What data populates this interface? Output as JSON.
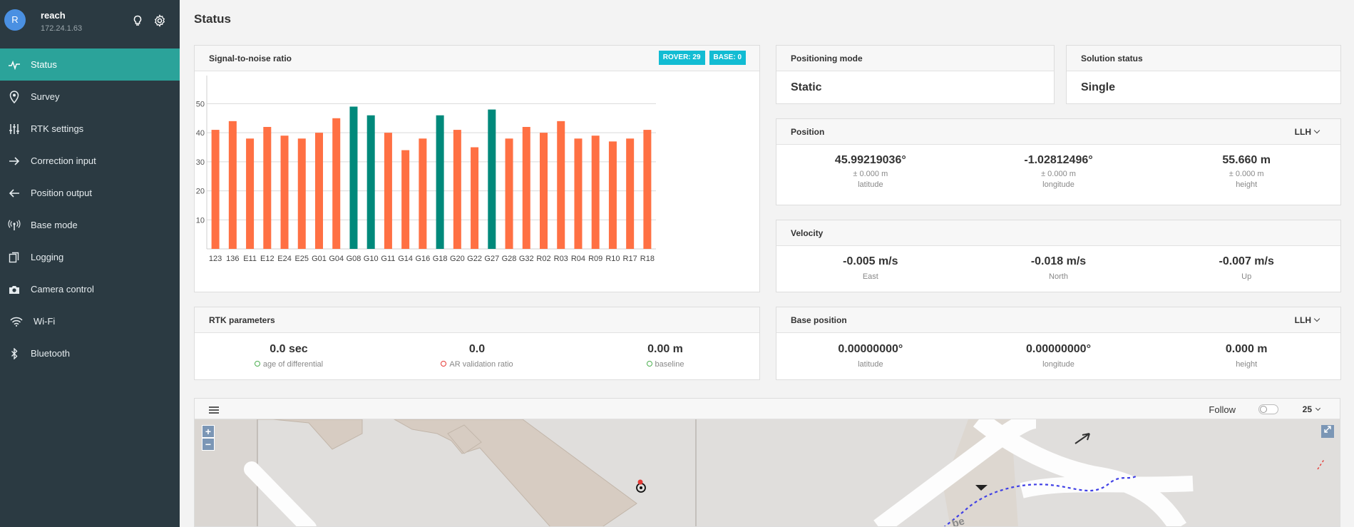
{
  "app": {
    "avatar_letter": "R",
    "device_name": "reach",
    "device_ip": "172.24.1.63"
  },
  "sidebar": {
    "items": [
      {
        "label": "Status",
        "icon": "pulse-icon",
        "active": true
      },
      {
        "label": "Survey",
        "icon": "map-pin-icon"
      },
      {
        "label": "RTK settings",
        "icon": "sliders-icon"
      },
      {
        "label": "Correction input",
        "icon": "arrow-right-icon"
      },
      {
        "label": "Position output",
        "icon": "arrow-left-icon"
      },
      {
        "label": "Base mode",
        "icon": "antenna-icon"
      },
      {
        "label": "Logging",
        "icon": "copy-icon"
      },
      {
        "label": "Camera control",
        "icon": "camera-icon"
      },
      {
        "label": "Wi-Fi",
        "icon": "wifi-icon"
      },
      {
        "label": "Bluetooth",
        "icon": "bluetooth-icon"
      }
    ]
  },
  "page": {
    "title": "Status"
  },
  "snr": {
    "title": "Signal-to-noise ratio",
    "rover_badge": "ROVER: 29",
    "base_badge": "BASE: 0"
  },
  "chart_data": {
    "type": "bar",
    "title": "Signal-to-noise ratio",
    "categories": [
      "123",
      "136",
      "E11",
      "E12",
      "E24",
      "E25",
      "G01",
      "G04",
      "G08",
      "G10",
      "G11",
      "G14",
      "G16",
      "G18",
      "G20",
      "G22",
      "G27",
      "G28",
      "G32",
      "R02",
      "R03",
      "R04",
      "R09",
      "R10",
      "R17",
      "R18"
    ],
    "values": [
      41,
      44,
      38,
      42,
      39,
      38,
      40,
      45,
      49,
      46,
      40,
      34,
      38,
      46,
      41,
      35,
      48,
      38,
      42,
      40,
      44,
      38,
      39,
      37,
      38,
      41
    ],
    "highlight": [
      false,
      false,
      false,
      false,
      false,
      false,
      false,
      false,
      true,
      true,
      false,
      false,
      false,
      true,
      false,
      false,
      true,
      false,
      false,
      false,
      false,
      false,
      false,
      false,
      false,
      false
    ],
    "yticks": [
      10,
      20,
      30,
      40,
      50
    ],
    "ylim": [
      0,
      56
    ],
    "colors": {
      "normal": "#ff7043",
      "highlight": "#00897b"
    },
    "grid": true
  },
  "positioning_mode": {
    "title": "Positioning mode",
    "value": "Static"
  },
  "solution_status": {
    "title": "Solution status",
    "value": "Single"
  },
  "position": {
    "title": "Position",
    "format": "LLH",
    "latitude": {
      "value": "45.99219036°",
      "sigma": "± 0.000 m",
      "label": "latitude"
    },
    "longitude": {
      "value": "-1.02812496°",
      "sigma": "± 0.000 m",
      "label": "longitude"
    },
    "height": {
      "value": "55.660 m",
      "sigma": "± 0.000 m",
      "label": "height"
    }
  },
  "velocity": {
    "title": "Velocity",
    "east": {
      "value": "-0.005 m/s",
      "label": "East"
    },
    "north": {
      "value": "-0.018 m/s",
      "label": "North"
    },
    "up": {
      "value": "-0.007 m/s",
      "label": "Up"
    }
  },
  "rtk": {
    "title": "RTK parameters",
    "age": {
      "value": "0.0 sec",
      "label": "age of differential",
      "status_color": "#4caf50"
    },
    "ar": {
      "value": "0.0",
      "label": "AR validation ratio",
      "status_color": "#e53935"
    },
    "baseline": {
      "value": "0.00 m",
      "label": "baseline",
      "status_color": "#4caf50"
    }
  },
  "base_position": {
    "title": "Base position",
    "format": "LLH",
    "latitude": {
      "value": "0.00000000°",
      "label": "latitude"
    },
    "longitude": {
      "value": "0.00000000°",
      "label": "longitude"
    },
    "height": {
      "value": "0.000 m",
      "label": "height"
    }
  },
  "map": {
    "follow_label": "Follow",
    "follow_on": false,
    "points_count": "25",
    "zoom_in": "+",
    "zoom_out": "−",
    "street_fragment": "be"
  }
}
